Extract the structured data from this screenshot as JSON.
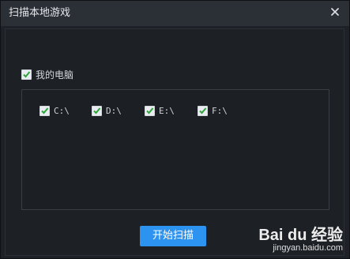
{
  "window": {
    "title": "扫描本地游戏"
  },
  "my_computer": {
    "label": "我的电脑",
    "checked": true
  },
  "drives": [
    {
      "label": "C:\\",
      "checked": true
    },
    {
      "label": "D:\\",
      "checked": true
    },
    {
      "label": "E:\\",
      "checked": true
    },
    {
      "label": "F:\\",
      "checked": true
    }
  ],
  "actions": {
    "start_label": "开始扫描"
  },
  "watermark": {
    "brand": "Bai du 经验",
    "url": "jingyan.baidu.com"
  },
  "colors": {
    "accent": "#2c93f0",
    "check": "#2fa43a",
    "background": "#1e2127",
    "titlebar": "#2b2f36"
  },
  "icons": {
    "close": "close-icon",
    "check": "checkmark-icon"
  }
}
